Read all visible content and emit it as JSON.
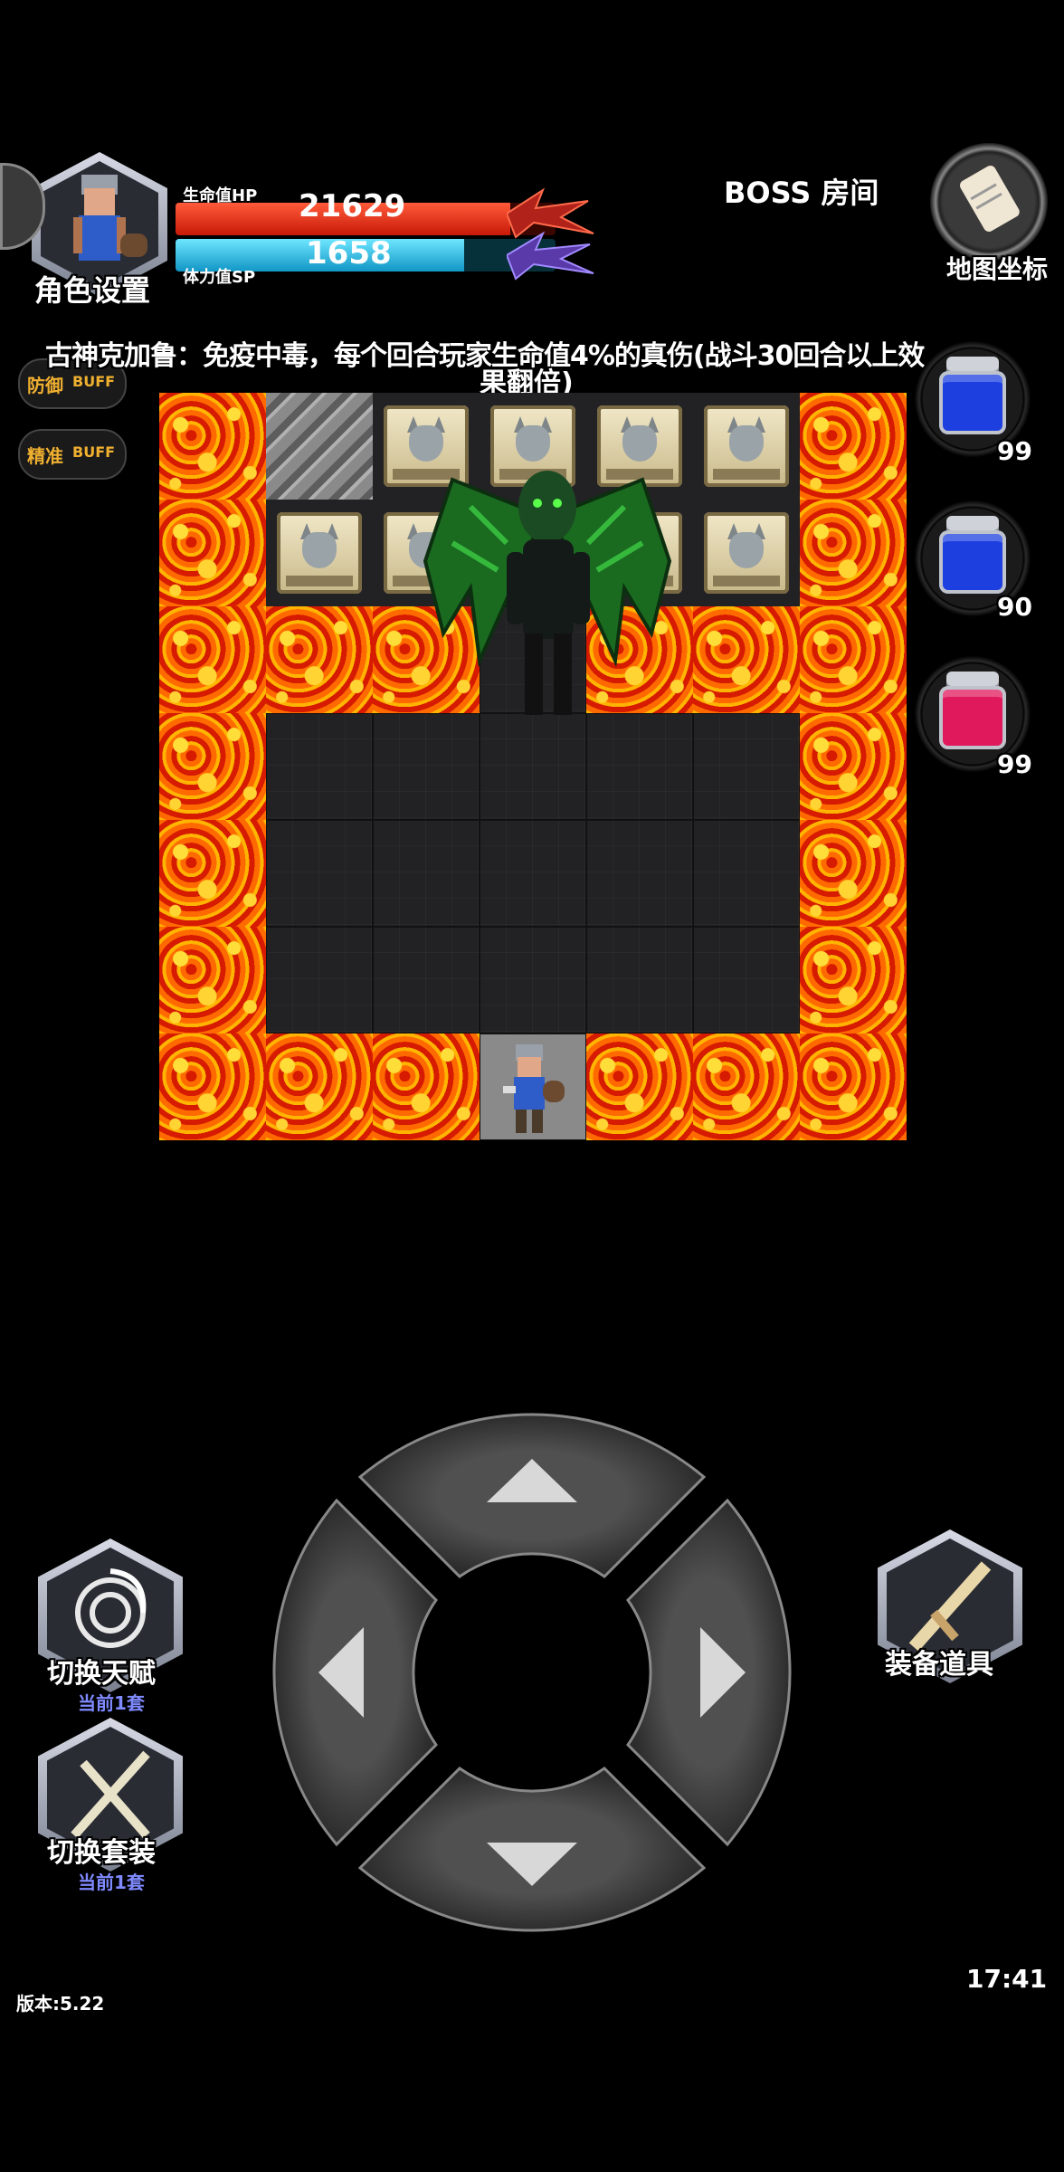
{
  "hud": {
    "character_settings_label": "角色设置",
    "hp_label": "生命值HP",
    "hp_value": "21629",
    "hp_fraction": 0.88,
    "sp_label": "体力值SP",
    "sp_value": "1658",
    "sp_fraction": 0.76,
    "room_title": "BOSS 房间",
    "map_coords_label": "地图坐标",
    "defense_buff_label": "防御",
    "accuracy_buff_label": "精准",
    "buff_tag": "BUFF"
  },
  "boss_effect_line1": "古神克加鲁：免疫中毒，每个回合玩家生命值4%的真伤(战斗30回合以上效",
  "boss_effect_line2": "果翻倍)",
  "potions": [
    {
      "color": "#1d3fe0",
      "count": "99"
    },
    {
      "color": "#1d3fe0",
      "count": "90"
    },
    {
      "color": "#e0185c",
      "count": "99"
    }
  ],
  "buttons": {
    "switch_talent": "切换天赋",
    "switch_talent_sub": "当前1套",
    "switch_outfit": "切换套装",
    "switch_outfit_sub": "当前1套",
    "equip_items": "装备道具"
  },
  "footer": {
    "version": "版本:5.22",
    "time": "17:41"
  },
  "colors": {
    "hp": "#e02a1a",
    "sp": "#1fb8e0",
    "lava": "#e32000",
    "floor": "#222224"
  },
  "map": {
    "grid": [
      "LSWWWWL",
      "LWWWWWL",
      "LLLBLLL",
      "LFFFFFL",
      "LFFFFFL",
      "LFFFFFL",
      "LLLPLLL"
    ]
  }
}
